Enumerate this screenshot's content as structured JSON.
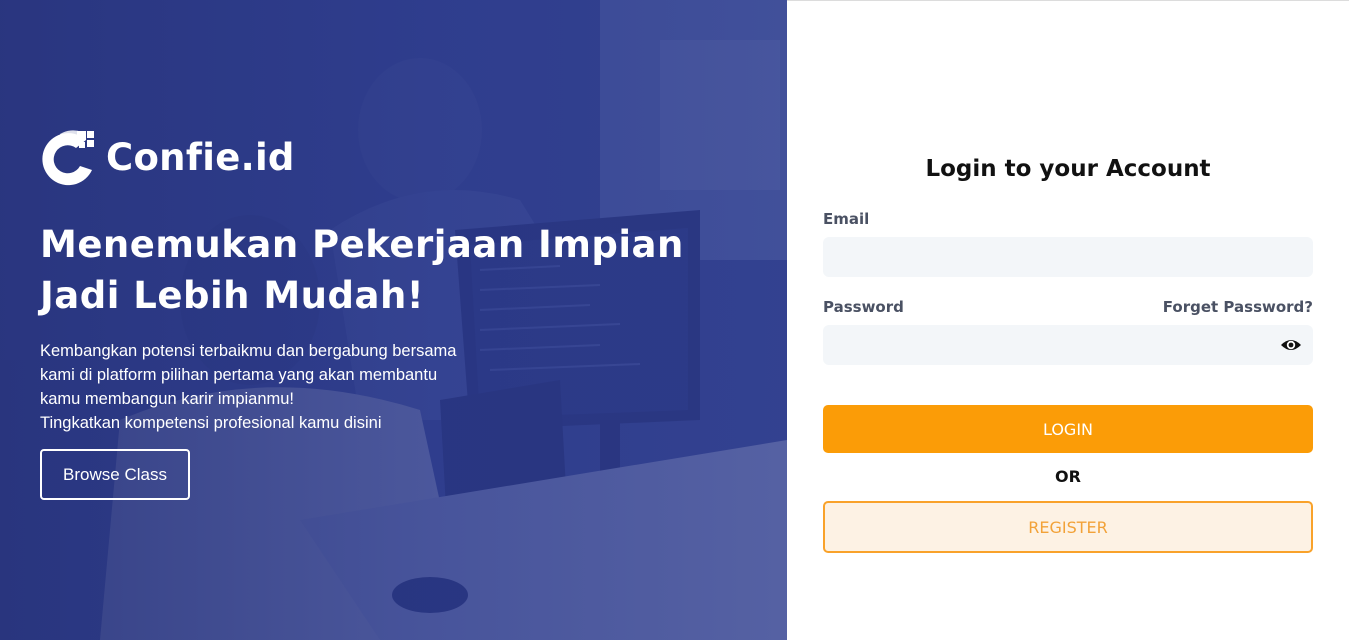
{
  "brand": {
    "name": "Confie.id",
    "logo_icon": "confie-logo-icon"
  },
  "hero": {
    "headline_line1": "Menemukan Pekerjaan Impian",
    "headline_line2": "Jadi Lebih Mudah!",
    "description_lines": [
      "Kembangkan potensi terbaikmu dan bergabung bersama",
      "kami di platform pilihan pertama yang akan membantu",
      "kamu membangun karir impianmu!",
      "Tingkatkan kompetensi profesional kamu disini"
    ],
    "browse_button": "Browse Class"
  },
  "login": {
    "title": "Login to your Account",
    "email_label": "Email",
    "email_value": "",
    "password_label": "Password",
    "password_value": "",
    "forget_password": "Forget Password?",
    "login_button": "LOGIN",
    "or_text": "OR",
    "register_button": "REGISTER"
  },
  "colors": {
    "hero_overlay": "#2b3a86",
    "primary": "#fb9c07",
    "register_bg": "#fdf2e4",
    "register_border": "#f9a22a",
    "field_bg": "#f3f6f9"
  },
  "icons": {
    "password_toggle": "eye-icon"
  }
}
